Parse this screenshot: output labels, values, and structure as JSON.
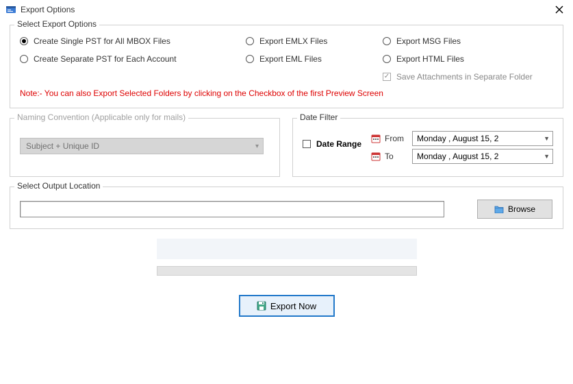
{
  "window": {
    "title": "Export Options"
  },
  "export_options": {
    "legend": "Select Export Options",
    "radio_items": [
      {
        "id": "single-pst",
        "label": "Create Single PST for All MBOX Files",
        "checked": true,
        "col": 1
      },
      {
        "id": "emlx",
        "label": "Export EMLX Files",
        "checked": false,
        "col": 2
      },
      {
        "id": "msg",
        "label": "Export MSG Files",
        "checked": false,
        "col": 3
      },
      {
        "id": "separate-pst",
        "label": "Create Separate PST for Each Account",
        "checked": false,
        "col": 1
      },
      {
        "id": "eml",
        "label": "Export EML Files",
        "checked": false,
        "col": 2
      },
      {
        "id": "html",
        "label": "Export HTML Files",
        "checked": false,
        "col": 3
      }
    ],
    "save_attachments": {
      "label": "Save Attachments in Separate Folder",
      "checked": true,
      "enabled": false
    },
    "note": "Note:- You can also Export Selected Folders by clicking on the Checkbox of the first Preview Screen"
  },
  "naming": {
    "legend": "Naming Convention (Applicable only for mails)",
    "selected": "Subject + Unique ID",
    "enabled": false
  },
  "date_filter": {
    "legend": "Date Filter",
    "range_label": "Date Range",
    "range_checked": false,
    "from_label": "From",
    "to_label": "To",
    "from_value": "Monday  ,    August    15, 2",
    "to_value": "Monday  ,    August    15, 2"
  },
  "output": {
    "legend": "Select Output Location",
    "path": "",
    "browse_label": "Browse"
  },
  "actions": {
    "export_label": "Export Now"
  }
}
